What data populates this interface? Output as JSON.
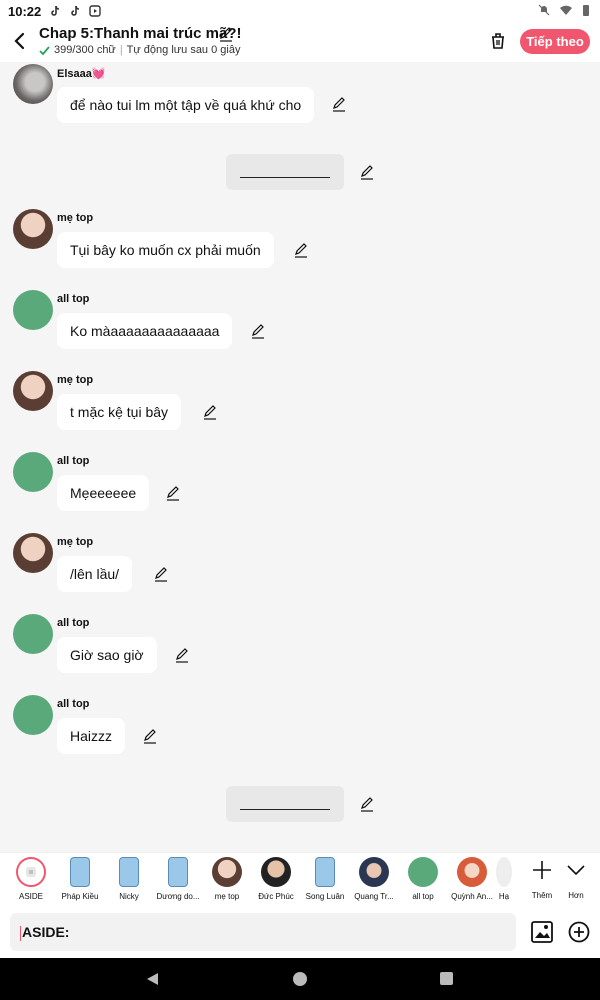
{
  "status": {
    "time": "10:22"
  },
  "header": {
    "title": "Chap 5:Thanh mai trúc mã?!",
    "word_count": "399/300 chữ",
    "autosave": "Tự động lưu sau 0 giây",
    "next_label": "Tiếp theo"
  },
  "messages": [
    {
      "author": "Elsaaa💓",
      "text": "để nào tui lm một tập về quá khứ cho"
    },
    {
      "author": "mẹ top",
      "text": "Tụi bây ko muốn cx phải muốn"
    },
    {
      "author": "all top",
      "text": "Ko màaaaaaaaaaaaaaa"
    },
    {
      "author": "mẹ top",
      "text": "t mặc kệ tụi bây"
    },
    {
      "author": "all top",
      "text": "Mẹeeeeee"
    },
    {
      "author": "mẹ top",
      "text": "/lên lầu/"
    },
    {
      "author": "all top",
      "text": "Giờ sao giờ"
    },
    {
      "author": "all top",
      "text": "Haizzz"
    }
  ],
  "characters": [
    {
      "label": "ASIDE"
    },
    {
      "label": "Pháp Kiều"
    },
    {
      "label": "Nicky"
    },
    {
      "label": "Dương do..."
    },
    {
      "label": "mẹ top"
    },
    {
      "label": "Đức Phúc"
    },
    {
      "label": "Song Luân"
    },
    {
      "label": "Quang Tr..."
    },
    {
      "label": "all top"
    },
    {
      "label": "Quỳnh An..."
    },
    {
      "label": "Hạ"
    }
  ],
  "tools": {
    "add_label": "Thêm",
    "more_label": "Hơn"
  },
  "input": {
    "value": "ASIDE:"
  },
  "colors": {
    "accent": "#f0566d",
    "background": "#f5f5f5"
  }
}
